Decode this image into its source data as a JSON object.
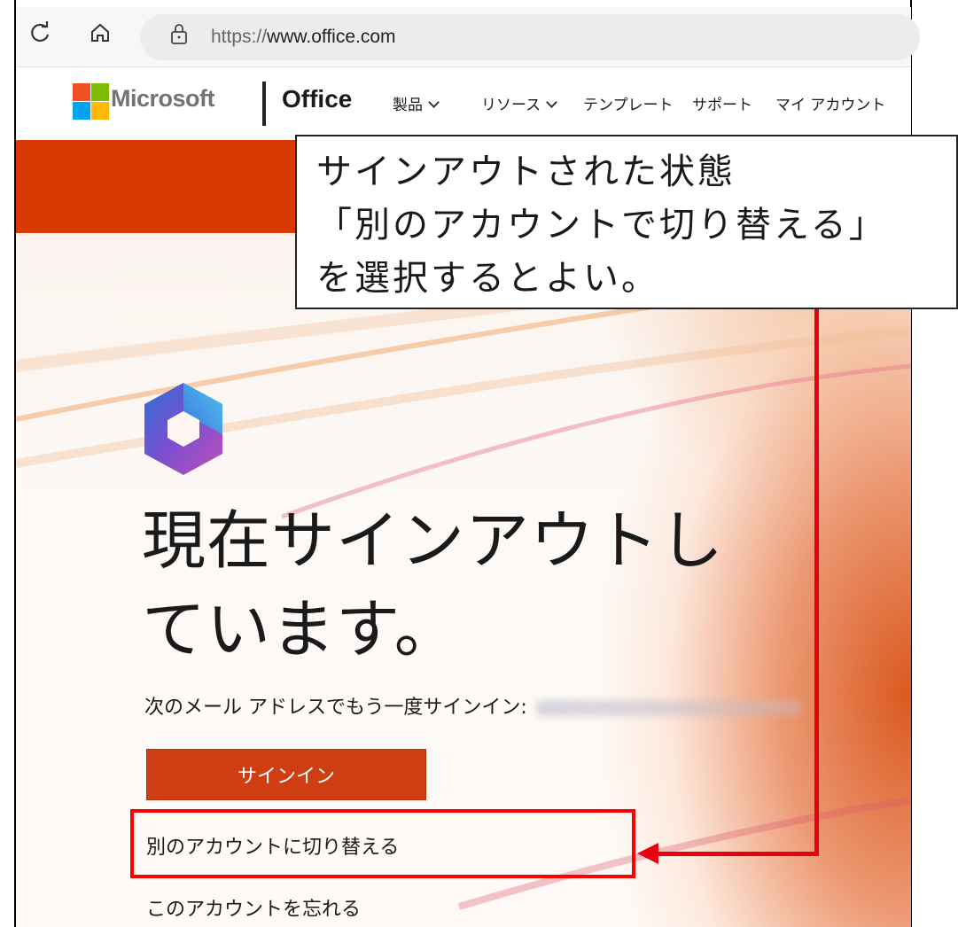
{
  "browser": {
    "url_scheme": "https://",
    "url_host": "www.office.com"
  },
  "header": {
    "brand": "Microsoft",
    "product": "Office",
    "nav": [
      {
        "label": "製品",
        "dropdown": true
      },
      {
        "label": "リソース",
        "dropdown": true
      },
      {
        "label": "テンプレート",
        "dropdown": false
      },
      {
        "label": "サポート",
        "dropdown": false
      },
      {
        "label": "マイ アカウント",
        "dropdown": false
      }
    ]
  },
  "callout": {
    "lines": [
      "サインアウトされた状態",
      "「別のアカウントで切り替える」",
      "を選択するとよい。"
    ]
  },
  "main": {
    "title_line1": "現在サインアウトし",
    "title_line2": "ています。",
    "email_prompt": "次のメール アドレスでもう一度サインイン:",
    "signin_button": "サインイン",
    "switch_account": "別のアカウントに切り替える",
    "forget_account": "このアカウントを忘れる"
  },
  "colors": {
    "office_orange": "#d83b01",
    "signin_button": "#cf3d12",
    "annotation_red": "#e60012",
    "ms_red": "#f25022",
    "ms_green": "#7fba00",
    "ms_blue": "#00a4ef",
    "ms_yellow": "#ffb900"
  }
}
